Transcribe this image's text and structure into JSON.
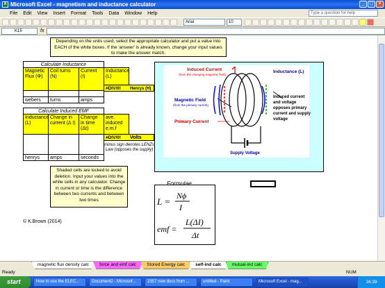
{
  "window": {
    "title": "Microsoft Excel - magnetism and inductance calculator",
    "app_icon": "excel-icon"
  },
  "menu": {
    "items": [
      "File",
      "Edit",
      "View",
      "Insert",
      "Format",
      "Tools",
      "Data",
      "Window",
      "Help"
    ],
    "help_placeholder": "Type a question for help"
  },
  "toolbar": {
    "font": "Arial",
    "size": "10"
  },
  "formula_bar": {
    "namebox": "K15",
    "fx": "fx",
    "value": ""
  },
  "instructions": "Depending on the units used, select the appropriate calculator and put a value into EACH of the white boxes. If the 'answer' is already known, change your input values to make the answer match.",
  "inductance_table": {
    "title": "Calculate Inductance",
    "headers": [
      "Magnetic Flux (Φ)",
      "Coil turns (N)",
      "Current (I)",
      "Inductance (L)"
    ],
    "result": "#DIV/0!",
    "result_unit": "Henrys (H)",
    "units": [
      "webers",
      "turns",
      "amps"
    ]
  },
  "emf_table": {
    "title": "Calculate Induced EMF",
    "headers": [
      "Inductance (L)",
      "Change in current (Δ I)",
      "Change in time (Δt)",
      "ave. induced e.m.f"
    ],
    "result": "#DIV/0!",
    "result_unit": "Volts",
    "note": "minus sign denotes LENZs Law (opposes the supply)",
    "units": [
      "henrys",
      "amps",
      "seconds"
    ]
  },
  "info_box": "Shaded cells are locked to avoid deletion. Input your values into the white cells in any calculator. Change in current or time is the difference between two currents and between two times",
  "copyright": "© K.Brown (2014)",
  "diagram": {
    "induced_current": "Induced Current",
    "induced_current_sub": "(from the changing magnetic field)",
    "inductance": "Inductance (L)",
    "magnetic_field": "Magnetic Field",
    "magnetic_field_sub": "(from the primary current)",
    "primary_current": "Primary Current",
    "induced_note": "Induced current and voltage opposes primary current and supply voltage",
    "supply_voltage": "Supply Voltage"
  },
  "formulae": {
    "title": "Formulae"
  },
  "sheet_tabs": [
    "magnetic flux density calc",
    "force and emf calc",
    "Stored Energy calc",
    "self-ind calc",
    "mutual-ind calc"
  ],
  "active_tab": "self-ind calc",
  "status": {
    "left": "Ready",
    "num": "NUM"
  },
  "taskbar": {
    "start": "start",
    "items": [
      "How to use the ELEC...",
      "Document2 - Microsof...",
      "2357 new docs from ...",
      "untitled - Paint",
      "Microsoft Excel - mag..."
    ],
    "clock": "16:39"
  },
  "colors": {
    "cell_yellow": "#ffff00",
    "cream": "#ffffcc",
    "cyan": "#ccffff",
    "tab_magenta": "#ff66ff",
    "tab_orange": "#ffcc66",
    "tab_lime": "#66ff66"
  }
}
